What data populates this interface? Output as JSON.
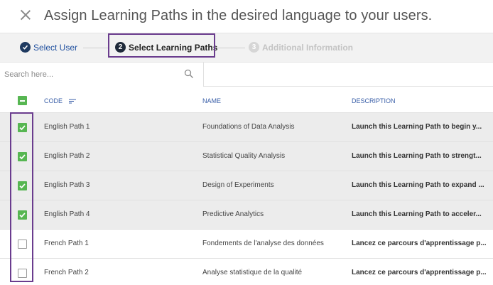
{
  "dialog": {
    "title": "Assign Learning Paths in the desired language to your users."
  },
  "stepper": {
    "steps": [
      {
        "number": "1",
        "label": "Select User",
        "state": "completed"
      },
      {
        "number": "2",
        "label": "Select Learning Paths",
        "state": "active"
      },
      {
        "number": "3",
        "label": "Additional Information",
        "state": "upcoming"
      }
    ]
  },
  "search": {
    "placeholder": "Search here...",
    "value": ""
  },
  "table": {
    "columns": [
      "CODE",
      "NAME",
      "DESCRIPTION"
    ],
    "header_checkbox": "partial",
    "rows": [
      {
        "code": "English Path 1",
        "name": "Foundations of Data Analysis",
        "description": "Launch this Learning Path to begin y...",
        "checked": true
      },
      {
        "code": "English Path 2",
        "name": "Statistical Quality Analysis",
        "description": "Launch this Learning Path to strengt...",
        "checked": true
      },
      {
        "code": "English Path 3",
        "name": "Design of Experiments",
        "description": "Launch this Learning Path to expand ...",
        "checked": true
      },
      {
        "code": "English Path 4",
        "name": "Predictive Analytics",
        "description": "Launch this Learning Path to acceler...",
        "checked": true
      },
      {
        "code": "French Path 1",
        "name": "Fondements de l'analyse des données",
        "description": "Lancez ce parcours d'apprentissage p...",
        "checked": false
      },
      {
        "code": "French Path 2",
        "name": "Analyse statistique de la qualité",
        "description": "Lancez ce parcours d'apprentissage p...",
        "checked": false
      }
    ]
  },
  "colors": {
    "accent_blue": "#1d4e9e",
    "checkbox_green": "#57b652",
    "highlight_purple": "#6a3c8e",
    "selected_row_bg": "#ececec"
  }
}
